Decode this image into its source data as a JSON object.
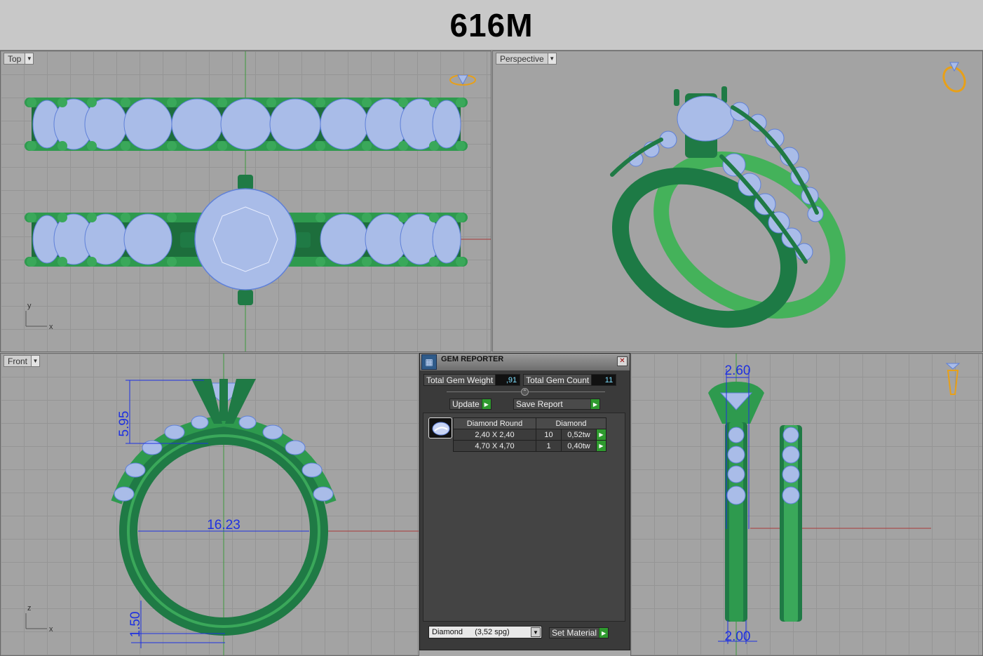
{
  "header": {
    "title": "616M"
  },
  "viewports": {
    "top": {
      "label": "Top",
      "axis_x": "x",
      "axis_y": "y"
    },
    "perspective": {
      "label": "Perspective"
    },
    "front": {
      "label": "Front",
      "axis_x": "x",
      "axis_z": "z"
    },
    "right": {
      "label": ""
    }
  },
  "dimensions": {
    "front_height": "5.95",
    "front_diameter": "16.23",
    "front_shank": "1.50",
    "right_width_top": "2.60",
    "right_width_bottom": "2.00"
  },
  "gem_reporter": {
    "title": "GEM REPORTER",
    "total_weight_label": "Total Gem Weight",
    "total_weight_value": ",91",
    "total_count_label": "Total Gem Count",
    "total_count_value": "11",
    "update_label": "Update",
    "save_report_label": "Save Report",
    "table": {
      "headers": [
        "Diamond Round",
        "Diamond"
      ],
      "rows": [
        {
          "size": "2,40 X 2,40",
          "count": "10",
          "weight": "0,52tw"
        },
        {
          "size": "4,70 X 4,70",
          "count": "1",
          "weight": "0,40tw"
        }
      ]
    },
    "material_name": "Diamond",
    "material_spg": "(3,52 spg)",
    "set_material_label": "Set Material"
  },
  "colors": {
    "metal_dark": "#1f7a45",
    "metal_light": "#44b25a",
    "gem": "#a9bce8",
    "gem_edge": "#5f80d8",
    "dim_line": "#1e30e0",
    "icon_gold": "#e8a018"
  }
}
